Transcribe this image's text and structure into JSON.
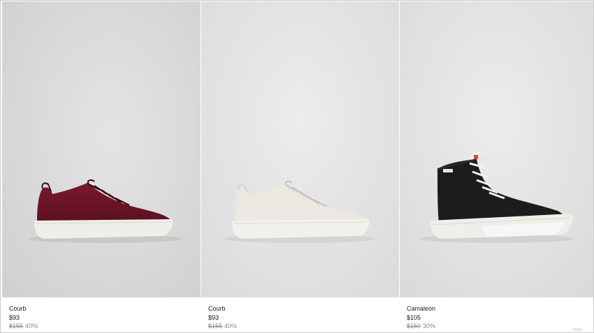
{
  "products": [
    {
      "name": "Courb",
      "price": "$93",
      "original_price": "$155",
      "discount": "40%",
      "shoe_color": "burgundy",
      "image": "burgundy-leather-sneaker"
    },
    {
      "name": "Courb",
      "price": "$93",
      "original_price": "$155",
      "discount": "40%",
      "shoe_color": "white",
      "image": "white-leather-sneaker"
    },
    {
      "name": "Camaleon",
      "price": "$105",
      "original_price": "$150",
      "discount": "30%",
      "shoe_color": "black",
      "image": "black-high-top-sneaker"
    }
  ],
  "colors": {
    "photo_bg_left": "#d2d2d2",
    "photo_bg_center": "#e6e6e6",
    "burgundy": "#6b1526",
    "white_shoe": "#ece9e2",
    "black_shoe": "#1b1b1b",
    "sole": "#eeeeea"
  }
}
